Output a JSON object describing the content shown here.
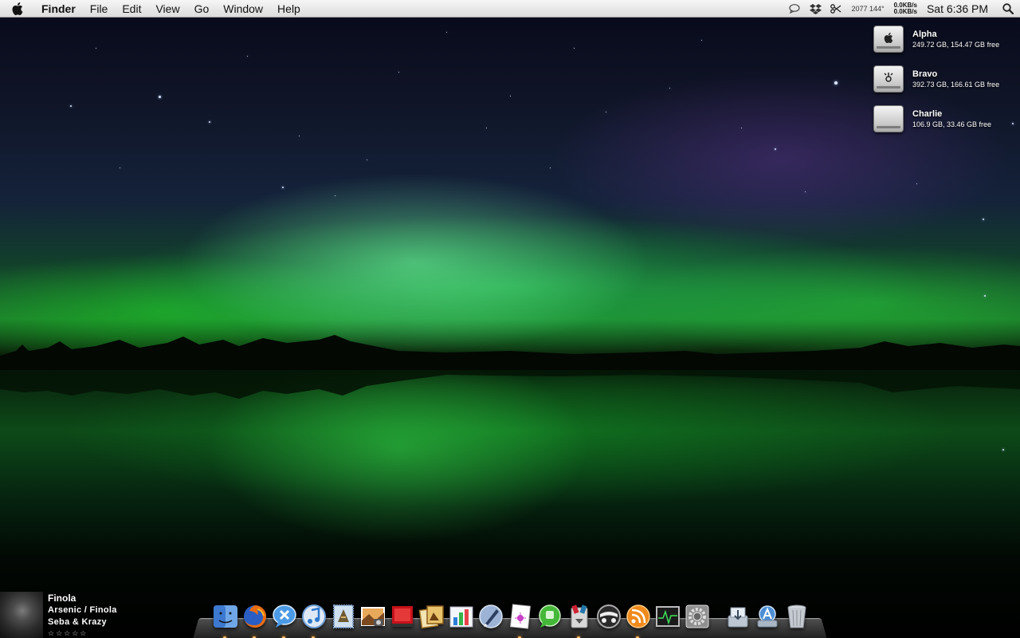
{
  "menubar": {
    "app_name": "Finder",
    "menus": [
      "File",
      "Edit",
      "View",
      "Go",
      "Window",
      "Help"
    ],
    "status": {
      "counter": "2077 144°",
      "net_up": "0.0KB/s",
      "net_down": "0.0KB/s",
      "clock": "Sat 6:36 PM"
    },
    "icons": [
      "apple-icon",
      "speech-bubble-icon",
      "dropbox-icon",
      "scissors-icon",
      "spotlight-icon"
    ]
  },
  "drives": [
    {
      "name": "Alpha",
      "info": "249.72 GB, 154.47 GB free",
      "icon": "apple-logo"
    },
    {
      "name": "Bravo",
      "info": "392.73 GB, 166.61 GB free",
      "icon": "firewire-symbol"
    },
    {
      "name": "Charlie",
      "info": "106.9 GB, 33.46 GB free",
      "icon": "blank"
    }
  ],
  "now_playing": {
    "title": "Finola",
    "album_track": "Arsenic / Finola",
    "artist": "Seba & Krazy",
    "rating": "☆☆☆☆☆"
  },
  "dock": {
    "items": [
      "finder",
      "firefox",
      "chat",
      "itunes",
      "mail",
      "image-capture",
      "photo-booth",
      "iphoto",
      "grapher",
      "pen-tool",
      "preview",
      "messaging",
      "archive-utility",
      "transmit",
      "rss",
      "activity-monitor",
      "system-preferences",
      "downloads",
      "applications",
      "trash"
    ]
  },
  "colors": {
    "aurora_green": "#2fd25a",
    "menubar": "#e8e8e8",
    "running_light": "#ffb860"
  }
}
